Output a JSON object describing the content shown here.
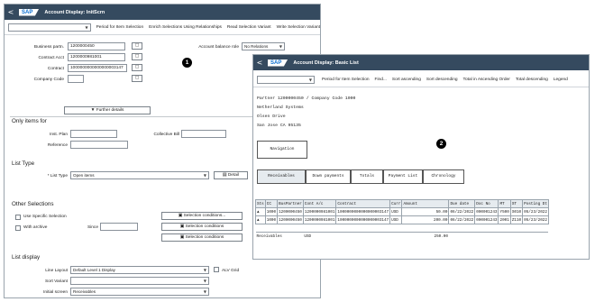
{
  "w1": {
    "back_glyph": "<",
    "brand": "SAP",
    "title": "Account Display: InitScrn",
    "toolbar": {
      "items": [
        "Period for Item Selection",
        "Enrich Selections Using Relationships",
        "Read Selection Variant",
        "Write Selection Variant"
      ]
    },
    "fields": {
      "business_partner_label": "Business partn.",
      "business_partner_value": "1200000450",
      "contract_acct_label": "Contract Acct",
      "contract_acct_value": "1200000981001",
      "contract_label": "Contract",
      "contract_value": "1000000000000000003147",
      "company_code_label": "Company Code",
      "company_code_value": "",
      "acct_balance_role_label": "Account balance role",
      "acct_balance_role_value": "No Relations"
    },
    "further_details": "Further details",
    "only_items_for": {
      "heading": "Only items for",
      "inst_plan_label": "Inst. Plan",
      "coll_bill_label": "Collective Bill",
      "reference_label": "Reference"
    },
    "list_type": {
      "heading": "List Type",
      "label": "* List Type",
      "value": "Open items",
      "detail_button": "Detail"
    },
    "other_selections": {
      "heading": "Other Selections",
      "use_specific_label": "Use Specific Selection",
      "with_archive_label": "With archive",
      "since_label": "Since",
      "selection_conditions": [
        "Selection conditions...",
        "Selection conditions",
        "Selection conditions"
      ]
    },
    "list_display": {
      "heading": "List display",
      "line_layout_label": "Line Layout",
      "line_layout_value": "Default Level 1 Display",
      "alv_grid_label": "ALV Grid",
      "sort_variant_label": "Sort Variant",
      "sort_variant_value": "",
      "initial_screen_label": "Initial screen",
      "initial_screen_value": "Receivables"
    }
  },
  "callouts": {
    "one": "1",
    "two": "2"
  },
  "w2": {
    "back_glyph": "<",
    "brand": "SAP",
    "title": "Account Display: Basic List",
    "toolbar": {
      "items": [
        "Period for Item Selection",
        "Find...",
        "Sort ascending",
        "Sort descending",
        "Total in Ascending Order",
        "Total descending",
        "Legend"
      ]
    },
    "header_lines": [
      "Partner 1200000450 / Company Code 1000",
      "Netherland Systems",
      "Olsen Drive",
      "San Jose CA  95135"
    ],
    "navigation_label": "Navigation",
    "tabs": [
      "Receivables",
      "Down payments",
      "Totals",
      "Payment List",
      "Chronology"
    ],
    "columns": [
      "Sts",
      "CC",
      "BusPartner",
      "Cont A/c",
      "Contract",
      "Curr",
      "Amount",
      "Due date",
      "Doc No",
      "MT",
      "ST",
      "Posting Dt"
    ],
    "rows": [
      [
        "▲",
        "1000",
        "1200000450",
        "1200000981001",
        "1000000000000000003147",
        "USD",
        "50.00",
        "06/22/2022",
        "000001243",
        "Y500",
        "S010",
        "05/23/2022"
      ],
      [
        "▲",
        "1000",
        "1200000450",
        "1200000981001",
        "1000000000000000003147",
        "USD",
        "200.00",
        "06/22/2022",
        "000001243",
        "2001",
        "Z110",
        "05/23/2022"
      ]
    ],
    "summary": {
      "label": "Receivables",
      "currency": "USD",
      "amount": "250.00"
    }
  }
}
